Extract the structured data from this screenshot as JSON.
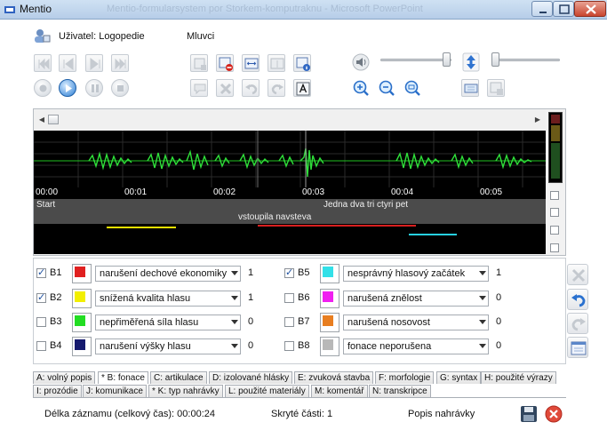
{
  "window": {
    "title": "Mentio",
    "ghost_title": "Mentio-formularsystem por Storkem-komputraknu - Microsoft PowerPoint"
  },
  "toolbar": {
    "user_label": "Uživatel: Logopedie",
    "speech_label": "Mluvci"
  },
  "waveform": {
    "time_labels": [
      "00:00",
      "00:01",
      "00:02",
      "00:03",
      "00:04",
      "00:05"
    ],
    "annotations_row1": [
      {
        "text": "Start"
      },
      {
        "text": "Jedna dva tri ctyri pet"
      }
    ],
    "annotations_row2": [
      {
        "text": "vstoupila navsteva"
      }
    ]
  },
  "items": [
    {
      "code": "B1",
      "checked": true,
      "color": "#e02020",
      "label": "narušení dechové ekonomiky",
      "count": "1"
    },
    {
      "code": "B2",
      "checked": true,
      "color": "#f2ef00",
      "label": "snížená kvalita hlasu",
      "count": "1"
    },
    {
      "code": "B3",
      "checked": false,
      "color": "#22dd22",
      "label": "nepřiměřená síla hlasu",
      "count": "0"
    },
    {
      "code": "B4",
      "checked": false,
      "color": "#151a6e",
      "label": "narušení výšky hlasu",
      "count": "0"
    },
    {
      "code": "B5",
      "checked": true,
      "color": "#32e0e8",
      "label": "nesprávný hlasový začátek",
      "count": "1"
    },
    {
      "code": "B6",
      "checked": false,
      "color": "#f020f0",
      "label": "narušená znělost",
      "count": "0"
    },
    {
      "code": "B7",
      "checked": false,
      "color": "#e87e20",
      "label": "narušená nosovost",
      "count": "0"
    },
    {
      "code": "B8",
      "checked": false,
      "color": "#b8b8b8",
      "label": "fonace neporušena",
      "count": "0"
    }
  ],
  "tabs_row1": [
    "A: volný popis",
    "* B: fonace",
    "C: artikulace",
    "D: izolované hlásky",
    "E: zvuková stavba",
    "F: morfologie",
    "G: syntax",
    "H: použité výrazy"
  ],
  "tabs_row2": [
    "I: prozódie",
    "J: komunikace",
    "* K: typ nahrávky",
    "L: použité materiály",
    "M: komentář",
    "N: transkripce"
  ],
  "status": {
    "duration": "Délka záznamu (celkový čas): 00:00:24",
    "hidden": "Skryté části: 1",
    "description": "Popis nahrávky"
  }
}
